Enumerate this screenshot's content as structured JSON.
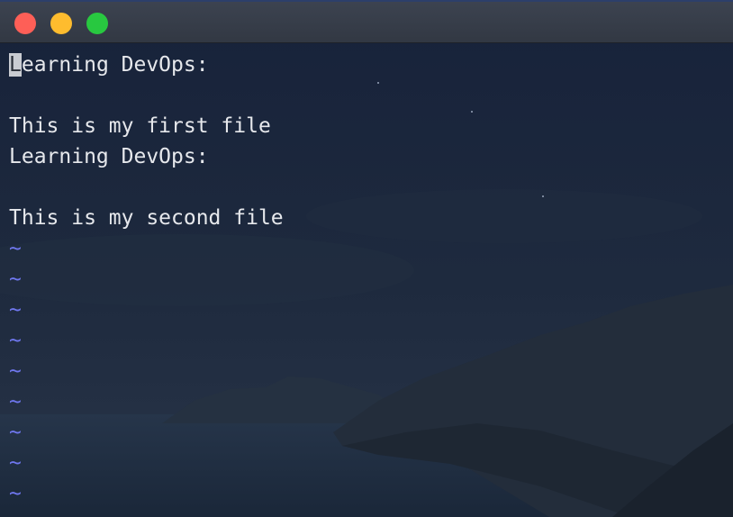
{
  "window": {
    "controls": [
      "close",
      "minimize",
      "zoom"
    ]
  },
  "editor": {
    "cursor_char": "L",
    "first_line_rest": "earning DevOps:",
    "lines": [
      "",
      "This is my first file",
      "Learning DevOps:",
      "",
      "This is my second file"
    ],
    "tilde": "~",
    "empty_lines": 9
  },
  "colors": {
    "close": "#fe5f57",
    "minimize": "#febc2e",
    "zoom": "#28c840",
    "text": "#e6e8ec",
    "tilde": "#6f77ee",
    "background": "#1a2436"
  }
}
